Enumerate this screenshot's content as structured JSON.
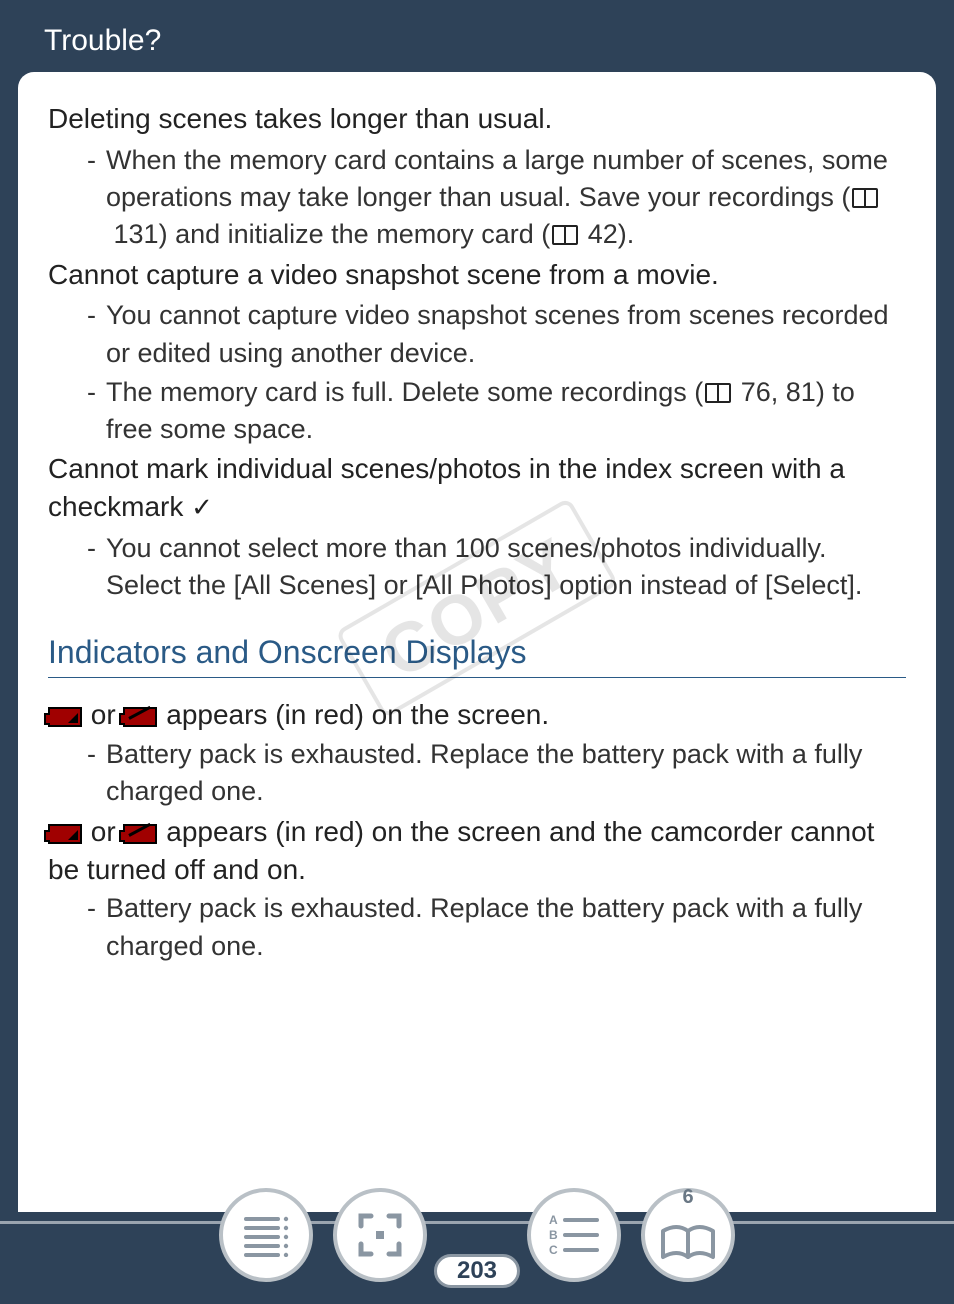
{
  "header": {
    "title": "Trouble?"
  },
  "watermark": "COPY",
  "issues": [
    {
      "title": "Deleting scenes takes longer than usual.",
      "bullets": [
        {
          "pre": "When the memory card contains a large number of scenes, some operations may take longer than usual. Save your recordings (",
          "ref1": "131",
          "mid": ") and initialize the memory card (",
          "ref2": "42",
          "post": ")."
        }
      ]
    },
    {
      "title": "Cannot capture a video snapshot scene from a movie.",
      "bullets": [
        {
          "pre": "You cannot capture video snapshot scenes from scenes recorded or edited using another device."
        },
        {
          "pre": "The memory card is full. Delete some recordings (",
          "ref1": "76, 81",
          "post": ") to free some space."
        }
      ]
    },
    {
      "title_pre": "Cannot mark individual scenes/photos in the index screen with a checkmark ",
      "check": "✓",
      "bullets": [
        {
          "pre": "You cannot select more than 100 scenes/photos individually. Select the [All Scenes] or [All Photos] option instead of [Select]."
        }
      ]
    }
  ],
  "section": {
    "title": "Indicators and Onscreen Displays"
  },
  "indicators": [
    {
      "or": " or ",
      "tail": " appears (in red) on the screen.",
      "bullet": "Battery pack is exhausted. Replace the battery pack with a fully charged one."
    },
    {
      "or": " or ",
      "tail": " appears (in red) on the screen and the camcorder cannot be turned off and on.",
      "bullet": "Battery pack is exhausted. Replace the battery pack with a fully charged one."
    }
  ],
  "nav": {
    "page_number": "203",
    "chapter": "6"
  }
}
